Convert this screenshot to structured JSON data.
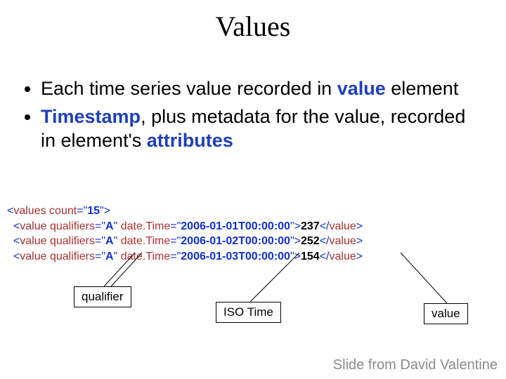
{
  "title": "Values",
  "bullets": {
    "b1a": "Each time series value recorded in ",
    "b1kw": "value",
    "b1b": " element",
    "b2a": "Timestamp",
    "b2b": ", plus metadata for the value, recorded in element's ",
    "b2kw": "attributes"
  },
  "code": {
    "open_tag": "values",
    "count_attr": "count",
    "count_val": "15",
    "rows": [
      {
        "qualifier": "A",
        "datetime": "2006-01-01T00:00:00",
        "value": "237"
      },
      {
        "qualifier": "A",
        "datetime": "2006-01-02T00:00:00",
        "value": "252"
      },
      {
        "qualifier": "A",
        "datetime": "2006-01-03T00:00:00",
        "value": "154"
      }
    ],
    "val_tag": "value",
    "qual_attr": "qualifiers",
    "dt_attr": "date.Time"
  },
  "labels": {
    "qualifier": "qualifier",
    "iso": "ISO Time",
    "value": "value"
  },
  "credit": "Slide from David Valentine"
}
